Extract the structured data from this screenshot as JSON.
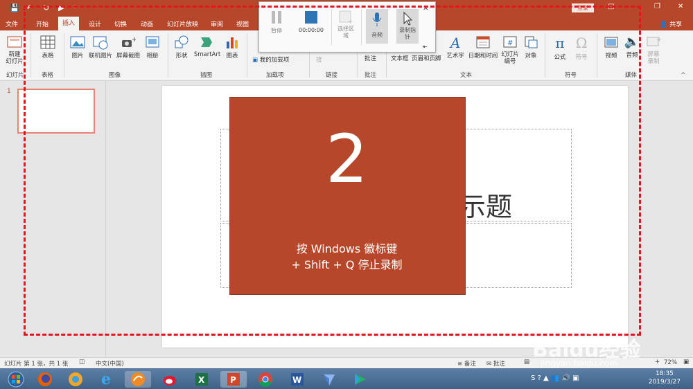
{
  "titlebar": {
    "login_label": "登录"
  },
  "tabs": [
    {
      "label": "文件"
    },
    {
      "label": "开始"
    },
    {
      "label": "插入"
    },
    {
      "label": "设计"
    },
    {
      "label": "切换"
    },
    {
      "label": "动画"
    },
    {
      "label": "幻灯片放映"
    },
    {
      "label": "审阅"
    },
    {
      "label": "视图"
    }
  ],
  "share_label": "共享",
  "ribbon": {
    "buttons": {
      "new_slide": "新建\n幻灯片",
      "table": "表格",
      "picture": "图片",
      "online_picture": "联机图片",
      "screenshot": "屏幕截图",
      "album": "相册",
      "shapes": "形状",
      "smartart": "SmartArt",
      "chart": "图表",
      "my_addins": "我的加载项",
      "link": "接",
      "comment": "批注",
      "text_box": "文本框",
      "header_footer": "页眉和页脚",
      "wordart": "艺术字",
      "datetime": "日期和时间",
      "slide_number": "幻灯片\n编号",
      "object": "对象",
      "equation": "公式",
      "symbol": "符号",
      "video": "视频",
      "audio": "音频",
      "screen_recording": "屏幕\n录制"
    },
    "groups": {
      "slides": "幻灯片",
      "tables": "表格",
      "images": "图像",
      "illustrations": "插图",
      "addins": "加载项",
      "links": "链接",
      "comments": "批注",
      "text": "文本",
      "symbols": "符号",
      "media": "媒体"
    }
  },
  "slide_panel": {
    "slide_number": "1"
  },
  "slide": {
    "title_fragment": "示题"
  },
  "overlay": {
    "countdown": "2",
    "message_line1": "按 Windows 徽标键",
    "message_line2": "+ Shift + Q 停止录制"
  },
  "recorder": {
    "pause": "暂停",
    "time": "00:00:00",
    "select_area": "选择区\n域",
    "audio": "音频",
    "record_pointer": "录制指\n针"
  },
  "statusbar": {
    "slide_info": "幻灯片 第 1 张，共 1 张",
    "language": "中文(中国)",
    "notes": "备注",
    "comments": "批注",
    "zoom": "72%"
  },
  "taskbar": {
    "time": "18:35",
    "date": "2019/3/27",
    "apps": [
      "start",
      "firefox",
      "browser-orb",
      "ie",
      "browser-app",
      "weibo",
      "excel",
      "powerpoint",
      "chrome",
      "word",
      "feather-app",
      "video-player"
    ]
  },
  "watermark": {
    "brand": "Baidu经验",
    "url": "jingyan.baidu.com"
  },
  "colors": {
    "accent": "#b7472a",
    "dashed": "#e8141c",
    "ribbon_bg": "#f3f3f3"
  }
}
